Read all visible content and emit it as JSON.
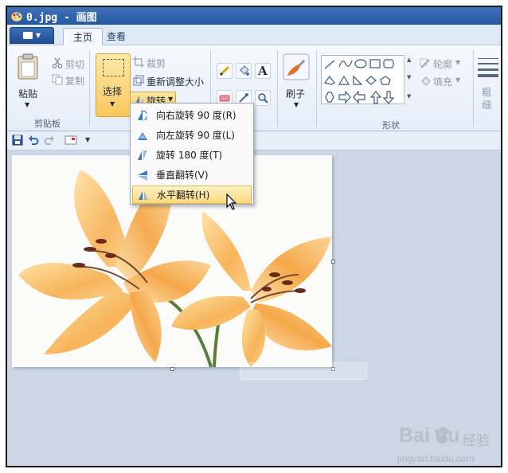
{
  "window": {
    "title": "0.jpg - 画图"
  },
  "tabs": [
    {
      "label": "主页",
      "active": true
    },
    {
      "label": "查看",
      "active": false
    }
  ],
  "clipboard": {
    "paste_label": "粘贴",
    "cut_label": "剪切",
    "copy_label": "复制",
    "group_label": "剪贴板"
  },
  "image_group": {
    "select_label": "选择",
    "crop_label": "裁剪",
    "resize_label": "重新调整大小",
    "rotate_label": "旋转"
  },
  "brushes": {
    "label": "刷子"
  },
  "shapes": {
    "outline_label": "轮廓",
    "fill_label": "填充",
    "group_label": "形状"
  },
  "size": {
    "label_1": "粗",
    "label_2": "细"
  },
  "rotate_menu": [
    {
      "label": "向右旋转 90 度(R)",
      "icon": "rotate-right-icon"
    },
    {
      "label": "向左旋转 90 度(L)",
      "icon": "rotate-left-icon"
    },
    {
      "label": "旋转 180 度(T)",
      "icon": "rotate-180-icon"
    },
    {
      "label": "垂直翻转(V)",
      "icon": "flip-vertical-icon"
    },
    {
      "label": "水平翻转(H)",
      "icon": "flip-horizontal-icon",
      "highlighted": true
    }
  ],
  "watermark": {
    "brand": "Bai du",
    "cn": "经验",
    "url": "jingyan.baidu.com"
  },
  "colors": {
    "title_bar": "#2558a0",
    "menu_highlight": "#fbd77c",
    "select_active": "#f8c85e",
    "canvas_bg": "#cdd6e4"
  }
}
